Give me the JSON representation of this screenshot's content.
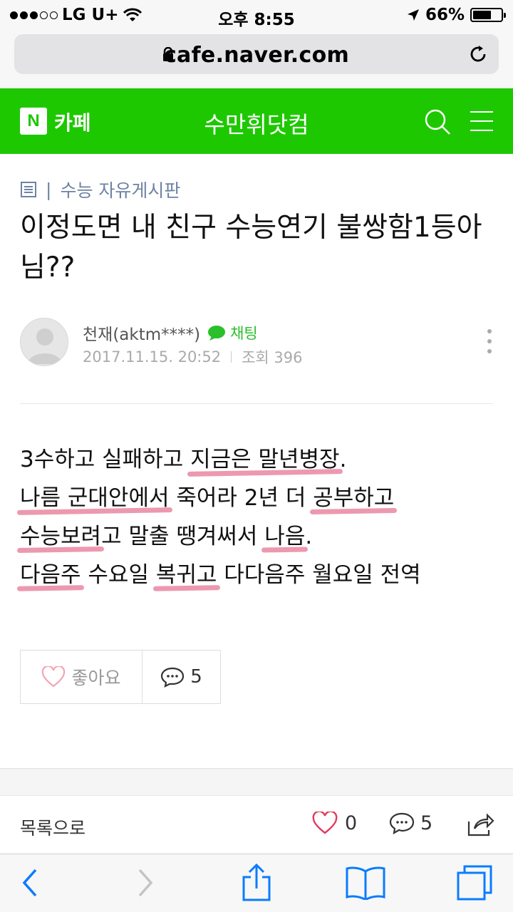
{
  "status_bar": {
    "carrier": "LG U+",
    "time": "오후 8:55",
    "battery_text": "66%",
    "battery_level": 0.66
  },
  "browser": {
    "url": "cafe.naver.com"
  },
  "header": {
    "logo_letter": "N",
    "cafe_label": "카페",
    "title": "수만휘닷컴"
  },
  "article": {
    "board": "수능 자유게시판",
    "title": "이정도면 내 친구 수능연기 불쌍함1등아님??",
    "author": "천재(aktm****)",
    "chat_label": "채팅",
    "date": "2017.11.15. 20:52",
    "views": "조회 396",
    "lines": [
      [
        {
          "t": "3수하고 실패하고 ",
          "h": false
        },
        {
          "t": "지금은 말년병장",
          "h": true
        },
        {
          "t": ".",
          "h": false
        }
      ],
      [
        {
          "t": "나름 군대안에서",
          "h": true
        },
        {
          "t": " 죽어라 2년 더 ",
          "h": false
        },
        {
          "t": "공부하고",
          "h": true
        }
      ],
      [
        {
          "t": "수능보려",
          "h": true
        },
        {
          "t": "고 말출 땡겨써서 ",
          "h": false
        },
        {
          "t": "나음",
          "h": true
        },
        {
          "t": ".",
          "h": false
        }
      ],
      [
        {
          "t": "다음주",
          "h": true
        },
        {
          "t": " 수요일 ",
          "h": false
        },
        {
          "t": "복귀고",
          "h": true
        },
        {
          "t": " 다다음주 월요일 전역",
          "h": false
        }
      ]
    ],
    "like_label": "좋아요",
    "comment_count": "5"
  },
  "bottom_bar": {
    "list_label": "목록으로",
    "like_count": "0",
    "comment_count": "5"
  },
  "colors": {
    "naver_green": "#1ec800",
    "ios_blue": "#0a7cff",
    "highlight": "#dc466e"
  }
}
